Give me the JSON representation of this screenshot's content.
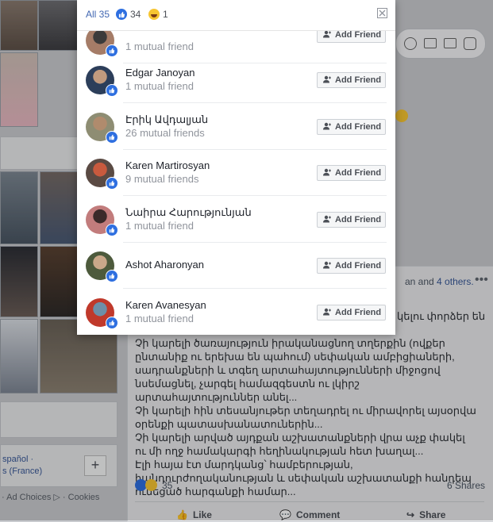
{
  "modal": {
    "tabs": [
      {
        "label": "All 35"
      },
      {
        "count": "34",
        "icon": "like-reaction-icon"
      },
      {
        "count": "1",
        "icon": "haha-reaction-icon"
      }
    ],
    "add_friend_label": "Add Friend",
    "people": [
      {
        "name": "",
        "mutual": "1 mutual friend"
      },
      {
        "name": "Edgar Janoyan",
        "mutual": "1 mutual friend"
      },
      {
        "name": "Էրիկ Ավդալյան",
        "mutual": "26 mutual friends"
      },
      {
        "name": "Karen Martirosyan",
        "mutual": "9 mutual friends"
      },
      {
        "name": "Նաիրա Հարությունյան",
        "mutual": "1 mutual friend"
      },
      {
        "name": "Ashot Aharonyan",
        "mutual": ""
      },
      {
        "name": "Karen Avanesyan",
        "mutual": "1 mutual friend"
      }
    ]
  },
  "post": {
    "header_tail": "an and",
    "header_link": "4 others.",
    "partial_line": "կելու փորձեր են",
    "body": "Չի կարելի ծառայություն իրականացնող տղերքին (ովքեր ընտանիք ու երեխա են պահում) սեփական ամբիցիաների, սադրանքների և տգեղ արտահայտությունների միջոցով նսեմացնել, չարգել համազգեստն ու լկիրշ արտահայտություններ անել...\nՉի կարելի հին տեսանյութեր տեղադրել ու միրավորել այսօրվա օրենքի պատասխանատուներին...\nՉի կարելի արված այդքան աշխատանքների վրա աչք փակել ու մի ողջ համակարգի հեղինակության հետ խաղալ...\nԷլի հայա էտ մարդկանց՝ համբերության, հանդուրժողականության և սեփական աշխատանքի հանդեպ ունեցած հարգանքի համար...",
    "reactions_count": "35",
    "shares": "6 Shares",
    "actions": [
      "Like",
      "Comment",
      "Share"
    ]
  },
  "sidebar": {
    "lang_1": "spañol ·",
    "lang_2": "s (France)",
    "footer": "· Ad Choices ▷ · Cookies"
  }
}
